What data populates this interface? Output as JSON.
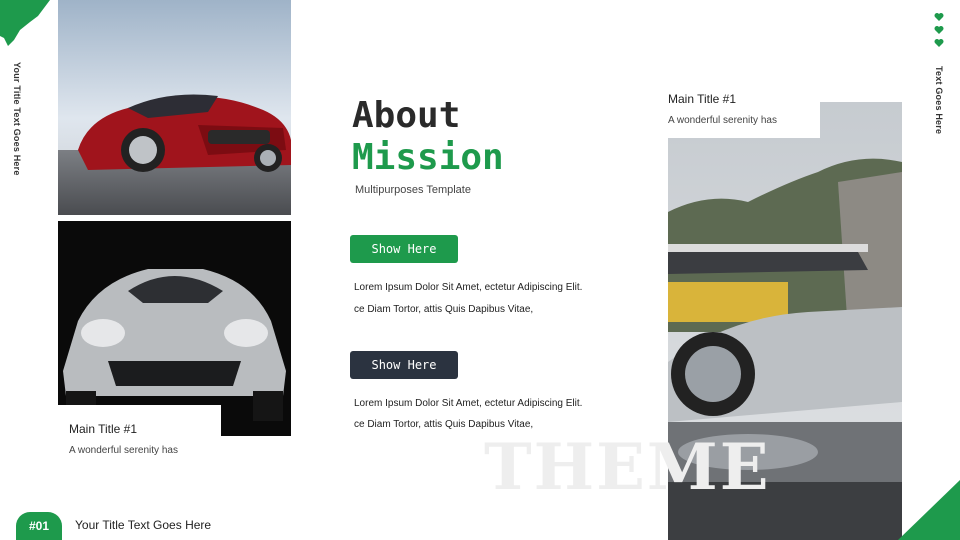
{
  "side": {
    "left_vertical": "Your Title Text Goes Here",
    "right_vertical": "Text Goes Here"
  },
  "header": {
    "title_line1": "About",
    "title_line2": "Mission",
    "subtitle": "Multipurposes Template"
  },
  "blocks": [
    {
      "button_label": "Show Here",
      "line1": "Lorem Ipsum Dolor Sit Amet, ectetur Adipiscing Elit.",
      "line2": "ce Diam Tortor, attis Quis Dapibus Vitae,"
    },
    {
      "button_label": "Show Here",
      "line1": "Lorem Ipsum Dolor Sit Amet, ectetur Adipiscing Elit.",
      "line2": "ce Diam Tortor, attis Quis Dapibus Vitae,"
    }
  ],
  "cards": {
    "left": {
      "title": "Main Title #1",
      "subtitle": "A wonderful serenity has"
    },
    "right": {
      "title": "Main Title #1",
      "subtitle": "A wonderful serenity has"
    }
  },
  "watermark": "THEME",
  "footer": {
    "page_badge": "#01",
    "title": "Your Title Text Goes Here"
  },
  "colors": {
    "accent": "#1e9a4c",
    "dark_button": "#2b3340"
  },
  "icons": [
    "heart-icon",
    "heart-icon",
    "heart-icon"
  ]
}
